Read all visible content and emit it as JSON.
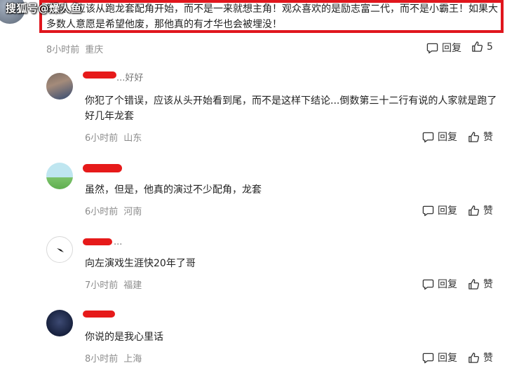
{
  "watermark": "搜狐号@燥人鱼",
  "top_comment": {
    "text": "错误，应该从跑龙套配角开始，而不是一来就想主角！观众喜欢的是励志富二代，而不是小霸王！如果大多数人意愿是希望他废，那他真的有才华也会被埋没！",
    "time": "8小时前",
    "location": "重庆",
    "reply_label": "回复",
    "like_count": "5"
  },
  "comments": [
    {
      "name_tail": "...好好",
      "text": "你犯了个错误，应该从头开始看到尾，而不是这样下结论...倒数第三十二行有说的人家就是跑了好几年龙套",
      "time": "6小时前",
      "location": "山东",
      "reply_label": "回复",
      "like_label": "赞"
    },
    {
      "text": "虽然，但是，他真的演过不少配角，龙套",
      "time": "6小时前",
      "location": "河南",
      "reply_label": "回复",
      "like_label": "赞"
    },
    {
      "name_tail": "...",
      "text": "向左演戏生涯快20年了哥",
      "time": "7小时前",
      "location": "福建",
      "reply_label": "回复",
      "like_label": "赞"
    },
    {
      "text": "你说的是我心里话",
      "time": "8小时前",
      "location": "上海",
      "reply_label": "回复",
      "like_label": "赞"
    }
  ]
}
